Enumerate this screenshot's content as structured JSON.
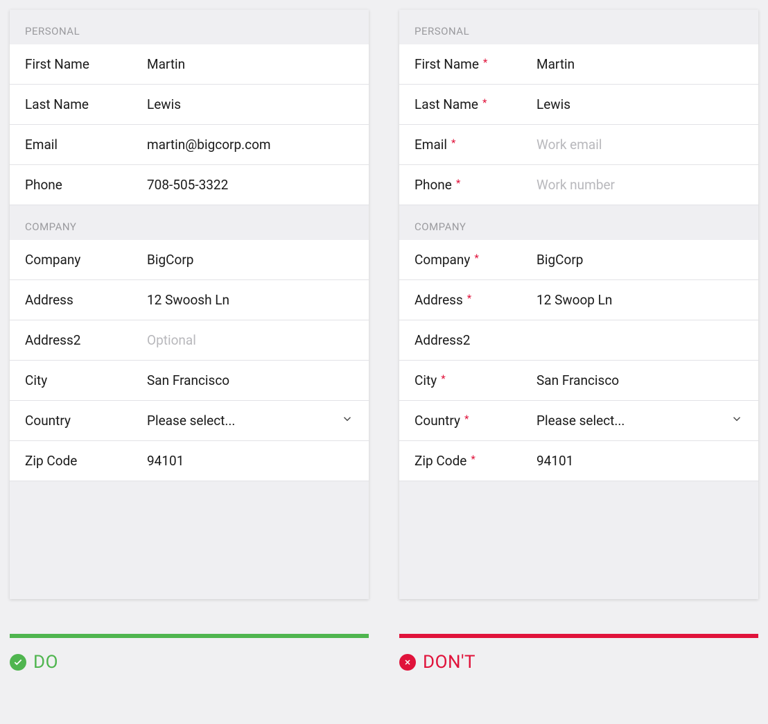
{
  "do_panel": {
    "sections": {
      "personal": {
        "title": "PERSONAL",
        "fields": {
          "first_name": {
            "label": "First Name",
            "value": "Martin"
          },
          "last_name": {
            "label": "Last Name",
            "value": "Lewis"
          },
          "email": {
            "label": "Email",
            "value": "martin@bigcorp.com"
          },
          "phone": {
            "label": "Phone",
            "value": "708-505-3322"
          }
        }
      },
      "company": {
        "title": "COMPANY",
        "fields": {
          "company": {
            "label": "Company",
            "value": "BigCorp"
          },
          "address": {
            "label": "Address",
            "value": "12 Swoosh Ln"
          },
          "address2": {
            "label": "Address2",
            "value": "",
            "placeholder": "Optional"
          },
          "city": {
            "label": "City",
            "value": "San Francisco"
          },
          "country": {
            "label": "Country",
            "value": "Please select..."
          },
          "zip": {
            "label": "Zip Code",
            "value": "94101"
          }
        }
      }
    }
  },
  "dont_panel": {
    "sections": {
      "personal": {
        "title": "PERSONAL",
        "fields": {
          "first_name": {
            "label": "First Name",
            "required": true,
            "value": "Martin"
          },
          "last_name": {
            "label": "Last Name",
            "required": true,
            "value": "Lewis"
          },
          "email": {
            "label": "Email",
            "required": true,
            "value": "",
            "placeholder": "Work email"
          },
          "phone": {
            "label": "Phone",
            "required": true,
            "value": "",
            "placeholder": "Work number"
          }
        }
      },
      "company": {
        "title": "COMPANY",
        "fields": {
          "company": {
            "label": "Company",
            "required": true,
            "value": "BigCorp"
          },
          "address": {
            "label": "Address",
            "required": true,
            "value": "12 Swoop Ln"
          },
          "address2": {
            "label": "Address2",
            "required": false,
            "value": ""
          },
          "city": {
            "label": "City",
            "required": true,
            "value": "San Francisco"
          },
          "country": {
            "label": "Country",
            "required": true,
            "value": "Please select..."
          },
          "zip": {
            "label": "Zip Code",
            "required": true,
            "value": "94101"
          }
        }
      }
    }
  },
  "footer": {
    "do_label": "DO",
    "dont_label": "DON'T"
  },
  "required_star": "*",
  "colors": {
    "green": "#4fb54f",
    "red": "#e0133b"
  }
}
